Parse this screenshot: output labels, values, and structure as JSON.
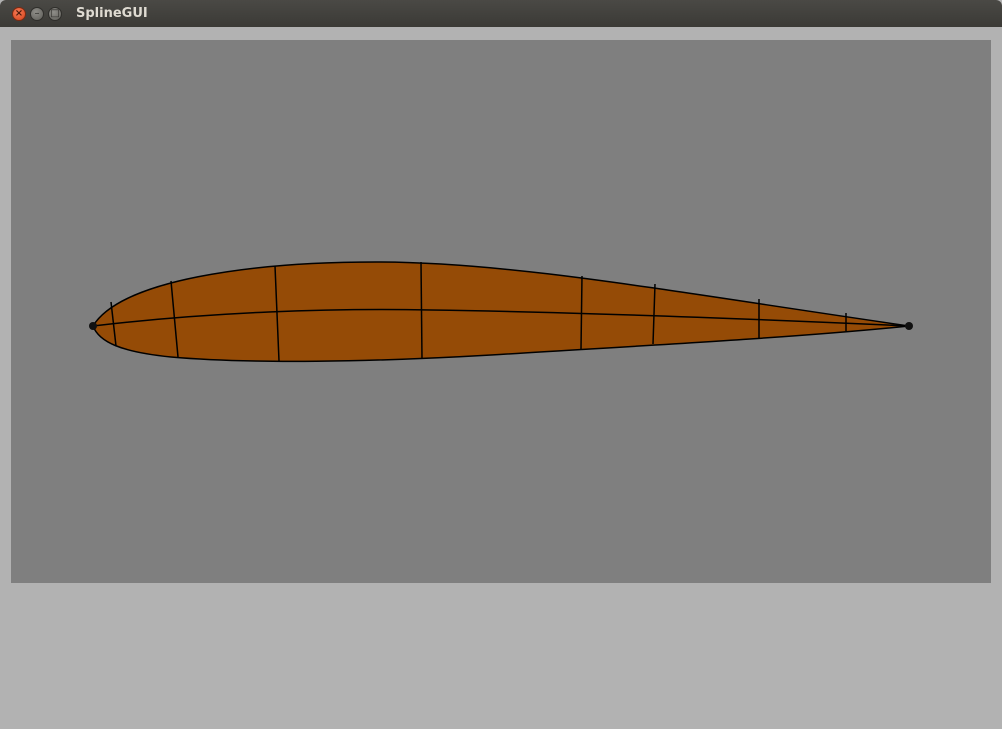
{
  "window": {
    "title": "SplineGUI",
    "buttons": {
      "close_icon": "close-icon",
      "minimize_icon": "minimize-icon",
      "maximize_icon": "maximize-icon"
    }
  },
  "canvas": {
    "background_color": "#7f7f7f",
    "shape": "airfoil",
    "fill_color": "#954b06",
    "stroke_color": "#000000",
    "control_points": 2
  }
}
